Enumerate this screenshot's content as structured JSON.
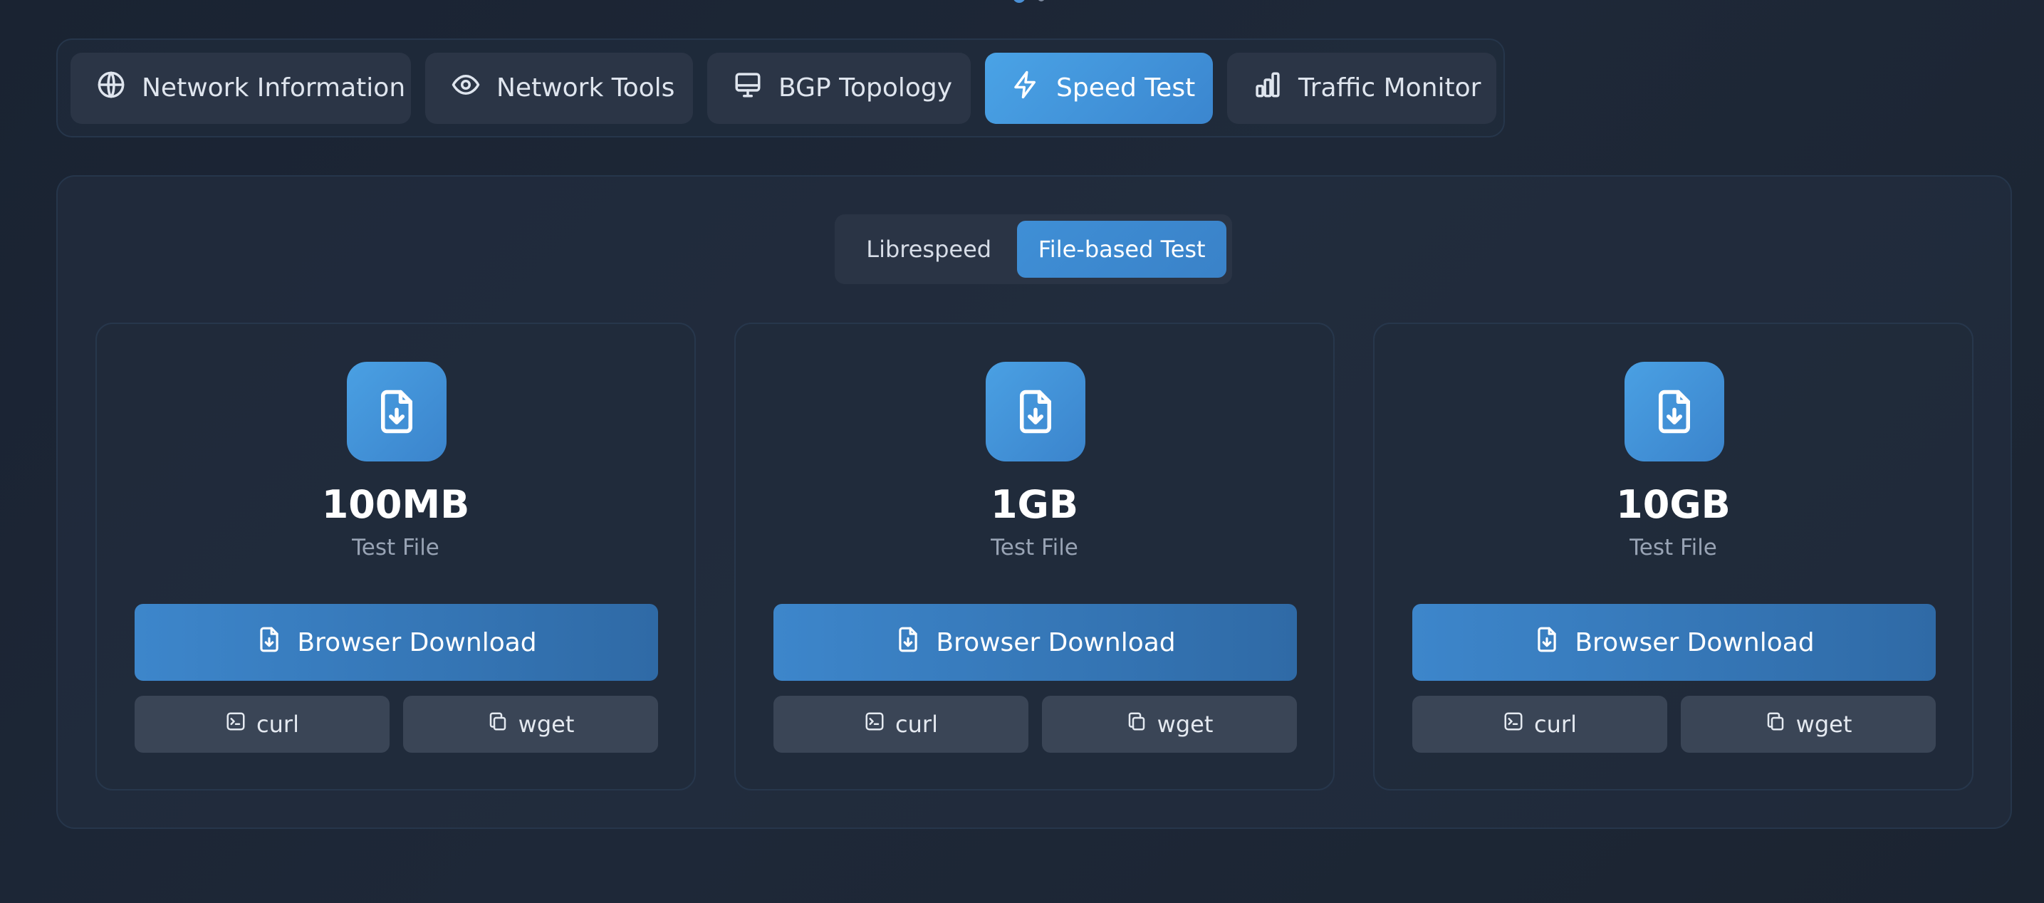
{
  "tabs": [
    {
      "label": "Network Information",
      "icon": "globe-icon",
      "active": false
    },
    {
      "label": "Network Tools",
      "icon": "eye-icon",
      "active": false
    },
    {
      "label": "BGP Topology",
      "icon": "monitor-icon",
      "active": false
    },
    {
      "label": "Speed Test",
      "icon": "lightning-icon",
      "active": true
    },
    {
      "label": "Traffic Monitor",
      "icon": "bar-chart-icon",
      "active": false
    }
  ],
  "speedtest_mode": {
    "options": [
      "Librespeed",
      "File-based Test"
    ],
    "selected": "File-based Test"
  },
  "files": [
    {
      "size": "100MB",
      "caption": "Test File",
      "download_label": "Browser Download",
      "curl_label": "curl",
      "wget_label": "wget"
    },
    {
      "size": "1GB",
      "caption": "Test File",
      "download_label": "Browser Download",
      "curl_label": "curl",
      "wget_label": "wget"
    },
    {
      "size": "10GB",
      "caption": "Test File",
      "download_label": "Browser Download",
      "curl_label": "curl",
      "wget_label": "wget"
    }
  ],
  "colors": {
    "accent": "#4aa3e6",
    "background": "#1a2332",
    "button_secondary": "#3a4556"
  }
}
